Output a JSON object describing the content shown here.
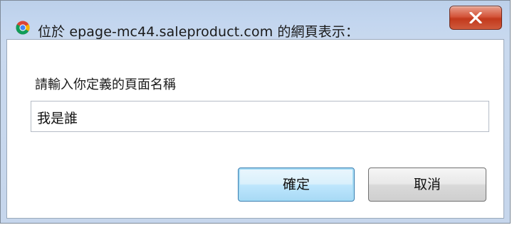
{
  "window": {
    "title": "位於 epage-mc44.saleproduct.com 的網頁表示："
  },
  "icons": {
    "app_icon": "chrome-icon",
    "close_icon": "close-x-icon"
  },
  "dialog": {
    "prompt_label": "請輸入你定義的頁面名稱",
    "input_value": "我是誰",
    "ok_label": "確定",
    "cancel_label": "取消"
  },
  "colors": {
    "close_button": "#c2391c",
    "ok_border": "#3c7fb1"
  }
}
